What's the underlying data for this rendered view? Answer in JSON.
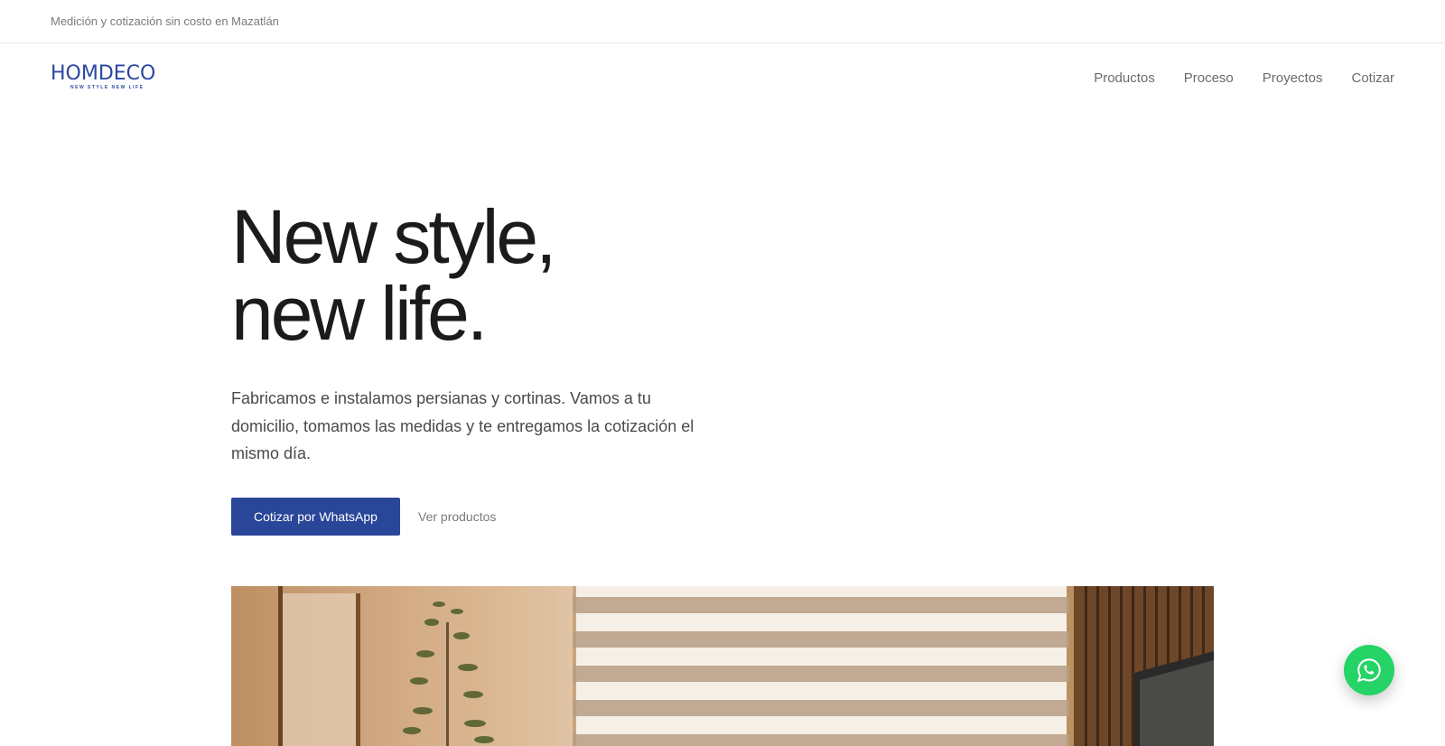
{
  "topbar": {
    "text": "Medición y cotización sin costo en Mazatlán"
  },
  "header": {
    "logo": {
      "word": "HOMDECO",
      "tagline": "NEW STYLE NEW LIFE",
      "brand_color": "#2a48a2"
    },
    "nav": [
      {
        "label": "Productos"
      },
      {
        "label": "Proceso"
      },
      {
        "label": "Proyectos"
      },
      {
        "label": "Cotizar"
      }
    ]
  },
  "hero": {
    "title_line1": "New style,",
    "title_line2": "new life.",
    "description": "Fabricamos e instalamos persianas y cortinas. Vamos a tu domicilio, tomamos las medidas y te entregamos la cotización el mismo día.",
    "primary_cta": "Cotizar por WhatsApp",
    "secondary_cta": "Ver productos",
    "primary_color": "#2a4699"
  },
  "floating": {
    "whatsapp_icon": "whatsapp-icon",
    "color": "#25d366"
  }
}
